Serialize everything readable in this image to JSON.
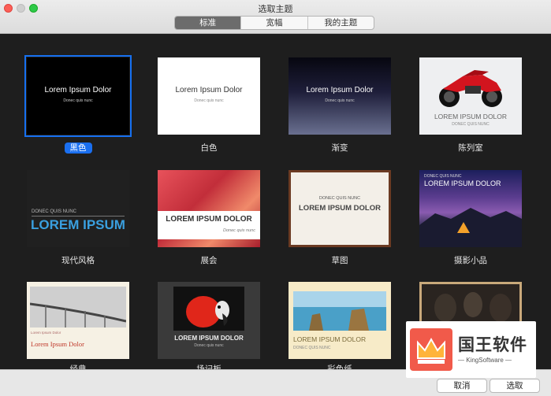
{
  "window": {
    "title": "选取主题"
  },
  "tabs": [
    {
      "label": "标准",
      "active": true
    },
    {
      "label": "宽幅",
      "active": false
    },
    {
      "label": "我的主题",
      "active": false
    }
  ],
  "themes": [
    {
      "name": "黑色",
      "title": "Lorem Ipsum Dolor",
      "subtitle": "Donec quis nunc",
      "selected": true
    },
    {
      "name": "白色",
      "title": "Lorem Ipsum Dolor",
      "subtitle": "Donec quis nunc"
    },
    {
      "name": "渐变",
      "title": "Lorem Ipsum Dolor",
      "subtitle": "Donec quis nunc"
    },
    {
      "name": "陈列室",
      "title": "LOREM IPSUM DOLOR",
      "subtitle": "DONEC QUIS NUNC"
    },
    {
      "name": "现代风格",
      "title": "LOREM IPSUM",
      "subtitle": "DONEC QUIS NUNC"
    },
    {
      "name": "展会",
      "title": "LOREM IPSUM DOLOR",
      "subtitle": "Donec quis nunc"
    },
    {
      "name": "草图",
      "title": "LOREM IPSUM DOLOR",
      "subtitle": "DONEC QUIS NUNC"
    },
    {
      "name": "摄影小品",
      "title": "LOREM IPSUM DOLOR",
      "subtitle": "DONEC QUIS NUNC"
    },
    {
      "name": "经典",
      "title": "Lorem Ipsum Dolor",
      "subtitle": "Lorem Ipsum Dolor"
    },
    {
      "name": "场记板",
      "title": "LOREM IPSUM DOLOR",
      "subtitle": "Donec quis nunc"
    },
    {
      "name": "彩色纸",
      "title": "LOREM IPSUM DOLOR",
      "subtitle": "DONEC QUIS NUNC"
    },
    {
      "name": "",
      "title": "",
      "subtitle": ""
    }
  ],
  "buttons": {
    "cancel": "取消",
    "choose": "选取"
  },
  "watermark": {
    "title": "国王软件",
    "subtitle": "KingSoftware"
  },
  "colors": {
    "accent": "#1a6ff0",
    "selection_outline": "#1670f0"
  }
}
